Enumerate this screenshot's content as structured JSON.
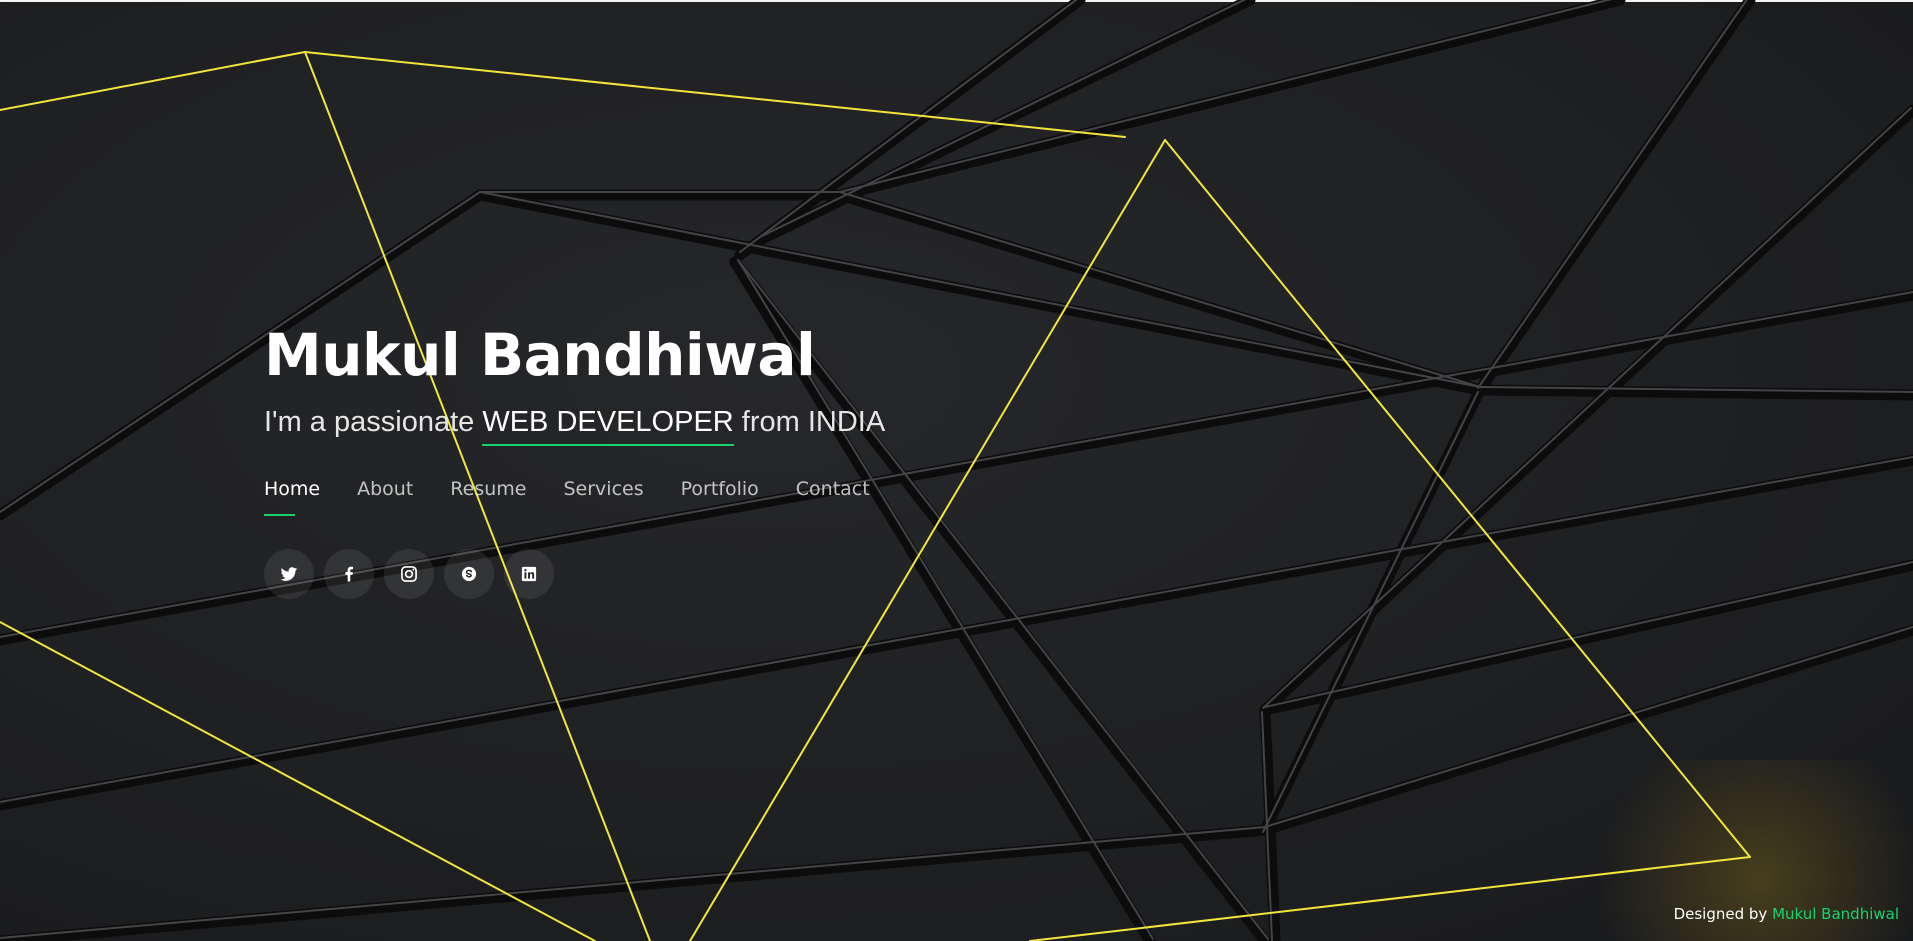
{
  "hero": {
    "name": "Mukul Bandhiwal",
    "tagline_prefix": "I'm a passionate ",
    "tagline_highlight": "WEB DEVELOPER",
    "tagline_suffix": " from INDIA"
  },
  "nav": {
    "items": [
      {
        "label": "Home",
        "active": true
      },
      {
        "label": "About"
      },
      {
        "label": "Resume"
      },
      {
        "label": "Services"
      },
      {
        "label": "Portfolio"
      },
      {
        "label": "Contact"
      }
    ]
  },
  "social": {
    "icons": [
      "twitter-icon",
      "facebook-icon",
      "instagram-icon",
      "skype-icon",
      "linkedin-icon"
    ]
  },
  "footer": {
    "credit_prefix": "Designed by ",
    "credit_name": "Mukul Bandhiwal"
  },
  "colors": {
    "accent": "#18d26e",
    "background": "#1f2022",
    "line_yellow": "#f2e53b",
    "text": "#ffffff"
  }
}
